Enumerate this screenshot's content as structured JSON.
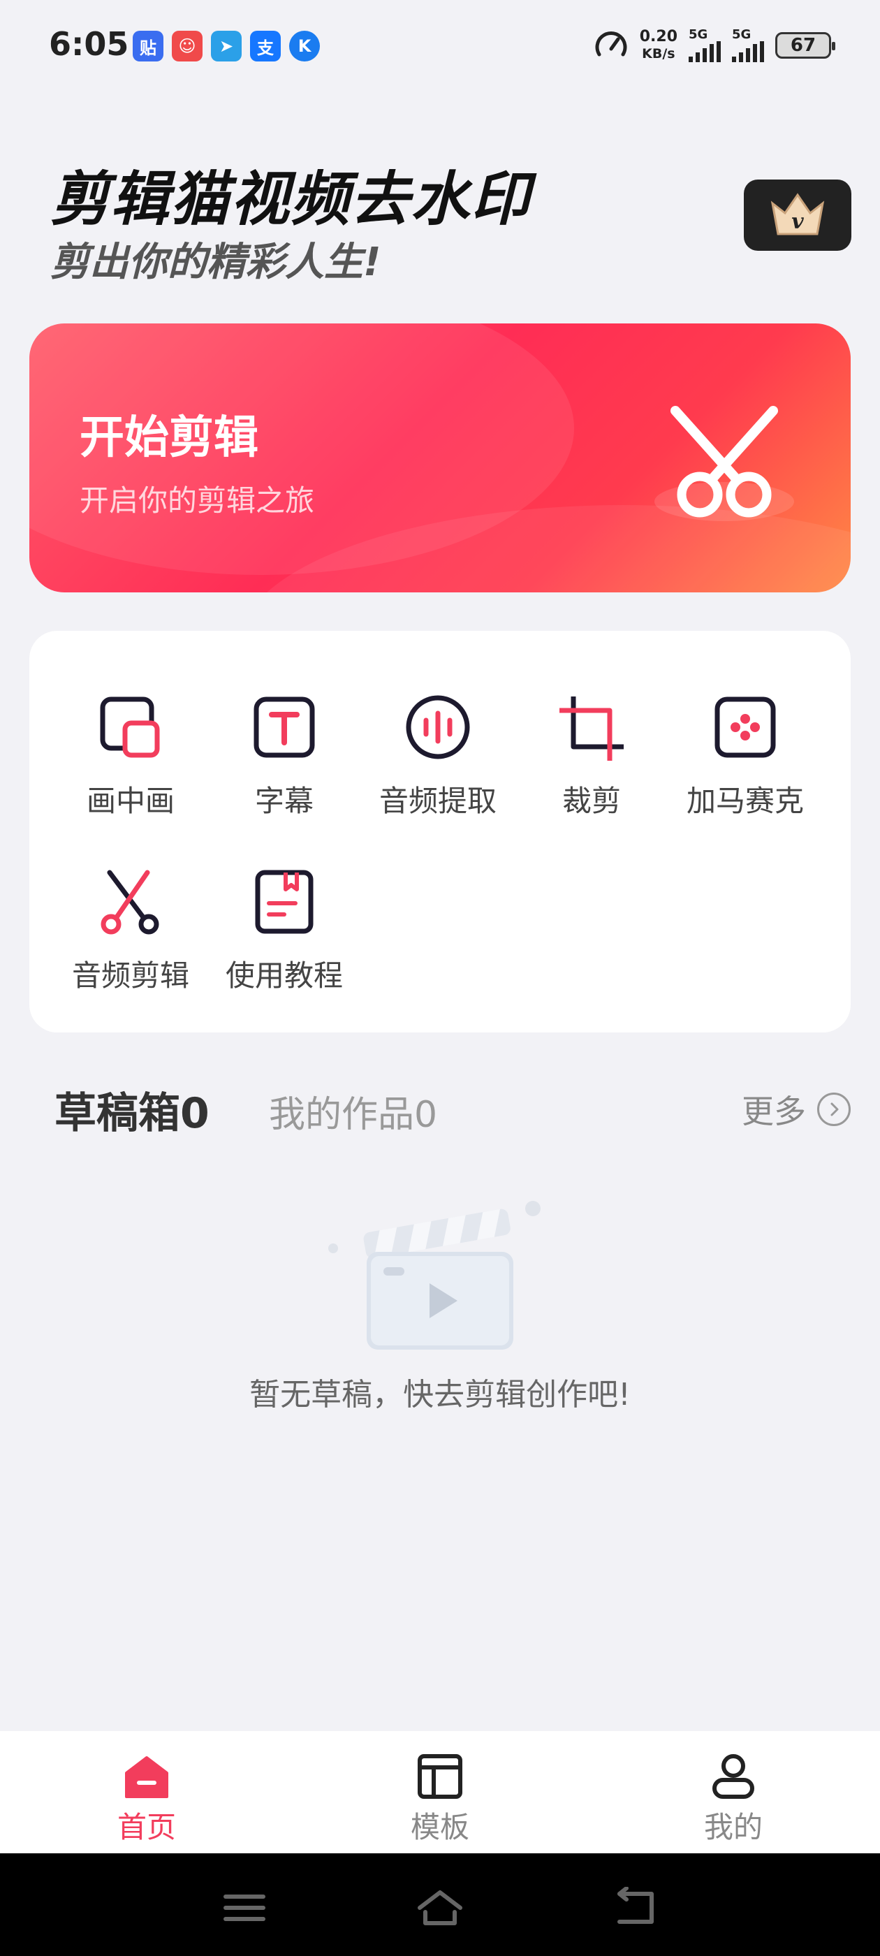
{
  "status_bar": {
    "time": "6:05",
    "apps": [
      {
        "icon": "tieba-icon",
        "glyph": "贴",
        "color": "#3a6df0"
      },
      {
        "icon": "clown-app-icon",
        "glyph": "☺",
        "color": "#f04a4a"
      },
      {
        "icon": "paper-plane-icon",
        "glyph": "➤",
        "color": "#2ba0e8"
      },
      {
        "icon": "alipay-icon",
        "glyph": "支",
        "color": "#1677ff"
      },
      {
        "icon": "k-app-icon",
        "glyph": "K",
        "color": "#1a7cf0"
      }
    ],
    "net_speed_value": "0.20",
    "net_speed_unit": "KB/s",
    "signal1_label": "5G",
    "signal2_label": "5G",
    "battery": "67"
  },
  "header": {
    "title": "剪辑猫视频去水印",
    "slogan": "剪出你的精彩人生!"
  },
  "banner": {
    "title": "开始剪辑",
    "subtitle": "开启你的剪辑之旅"
  },
  "tools": [
    {
      "label": "画中画",
      "icon": "picture-in-picture-icon"
    },
    {
      "label": "字幕",
      "icon": "subtitle-icon"
    },
    {
      "label": "音频提取",
      "icon": "audio-extract-icon"
    },
    {
      "label": "裁剪",
      "icon": "crop-icon"
    },
    {
      "label": "加马赛克",
      "icon": "mosaic-icon"
    },
    {
      "label": "音频剪辑",
      "icon": "audio-cut-icon"
    },
    {
      "label": "使用教程",
      "icon": "tutorial-icon"
    }
  ],
  "tabs": {
    "drafts": "草稿箱0",
    "works": "我的作品0",
    "more": "更多"
  },
  "empty_state": {
    "text": "暂无草稿，快去剪辑创作吧!"
  },
  "bottom_nav": {
    "items": [
      {
        "label": "首页",
        "icon": "home-icon",
        "active": true
      },
      {
        "label": "模板",
        "icon": "template-icon",
        "active": false
      },
      {
        "label": "我的",
        "icon": "profile-icon",
        "active": false
      }
    ]
  },
  "colors": {
    "accent": "#f23d5c",
    "icon_dark": "#1d1a2e"
  }
}
